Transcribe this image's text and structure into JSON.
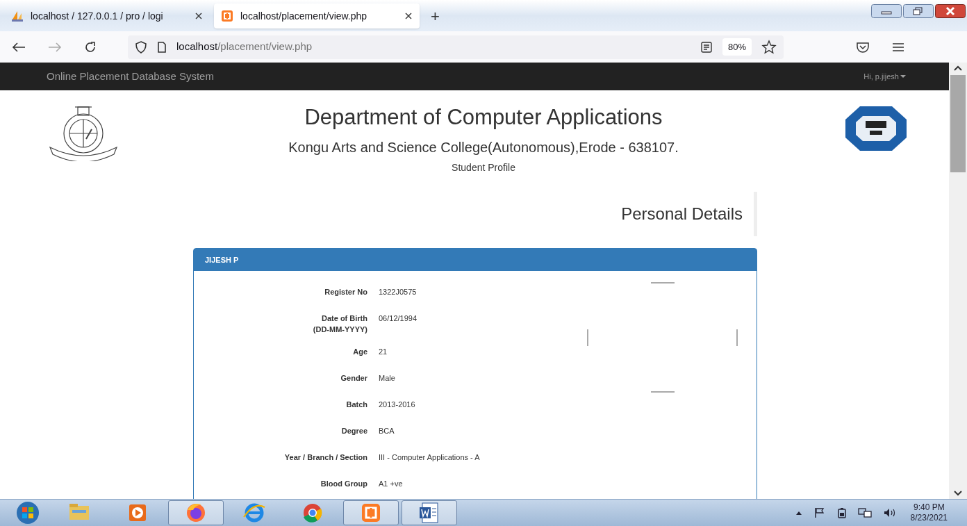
{
  "browser": {
    "tabs": [
      {
        "title": "localhost / 127.0.0.1 / pro / logi",
        "kind": "pma",
        "selected": false
      },
      {
        "title": "localhost/placement/view.php",
        "kind": "xampp",
        "selected": true
      }
    ],
    "new_tab": "+",
    "address": {
      "host": "localhost",
      "path": "/placement/view.php"
    },
    "zoom": "80%"
  },
  "navbar": {
    "brand": "Online Placement Database System",
    "user": "Hi, p.jijesh"
  },
  "header": {
    "title": "Department of Computer Applications",
    "college": "Kongu Arts and Science College(Autonomous),Erode - 638107.",
    "subtitle": "Student Profile"
  },
  "section_title": "Personal Details",
  "panel": {
    "name": "JIJESH P",
    "rows": [
      {
        "label": "Register No",
        "value": "1322J0575"
      },
      {
        "label": "Date of Birth\n(DD-MM-YYYY)",
        "value": "06/12/1994"
      },
      {
        "label": "Age",
        "value": "21"
      },
      {
        "label": "Gender",
        "value": "Male"
      },
      {
        "label": "Batch",
        "value": "2013-2016"
      },
      {
        "label": "Degree",
        "value": "BCA"
      },
      {
        "label": "Year / Branch / Section",
        "value": "III - Computer Applications - A"
      },
      {
        "label": "Blood Group",
        "value": "A1 +ve"
      }
    ]
  },
  "taskbar": {
    "apps": [
      {
        "kind": "explorer",
        "active": false
      },
      {
        "kind": "media",
        "active": false
      },
      {
        "kind": "firefox",
        "active": true
      },
      {
        "kind": "ie",
        "active": false
      },
      {
        "kind": "chrome",
        "active": false
      },
      {
        "kind": "xampp",
        "active": true
      },
      {
        "kind": "word",
        "active": true
      }
    ],
    "time": "9:40 PM",
    "date": "8/23/2021"
  }
}
